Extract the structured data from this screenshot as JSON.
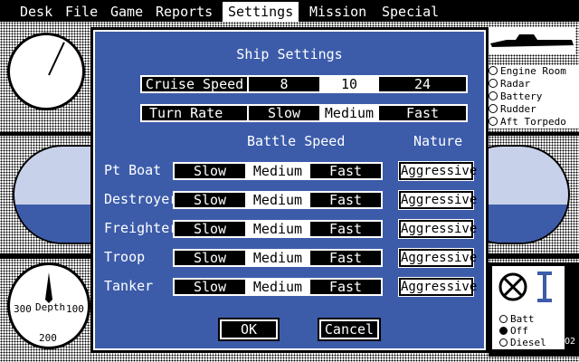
{
  "menubar": {
    "items": [
      "Desk",
      "File",
      "Game",
      "Reports",
      "Settings",
      "Mission",
      "Special"
    ],
    "active": "Settings"
  },
  "background": {
    "systems": [
      "Engine Room",
      "Radar",
      "Battery",
      "Rudder",
      "Aft Torpedo"
    ],
    "depth_gauge": {
      "label": "Depth",
      "left_value": "300",
      "right_value": "100",
      "bottom_value": "200"
    },
    "power_options": [
      "Batt",
      "Off",
      "Diesel"
    ],
    "power_selected": "Off",
    "oxygen_label": "O2"
  },
  "dialog": {
    "title": "Ship Settings",
    "cruise_speed": {
      "label": "Cruise Speed",
      "options": [
        "8",
        "10",
        "24"
      ],
      "selected": "10"
    },
    "turn_rate": {
      "label": "Turn Rate",
      "options": [
        "Slow",
        "Medium",
        "Fast"
      ],
      "selected": "Medium"
    },
    "battle_speed_header": "Battle Speed",
    "nature_header": "Nature",
    "ships": [
      {
        "name": "Pt Boat",
        "options": [
          "Slow",
          "Medium",
          "Fast"
        ],
        "selected": "Medium",
        "nature": "Aggressive"
      },
      {
        "name": "Destroyer",
        "options": [
          "Slow",
          "Medium",
          "Fast"
        ],
        "selected": "Medium",
        "nature": "Aggressive"
      },
      {
        "name": "Freighter",
        "options": [
          "Slow",
          "Medium",
          "Fast"
        ],
        "selected": "Medium",
        "nature": "Aggressive"
      },
      {
        "name": "Troop",
        "options": [
          "Slow",
          "Medium",
          "Fast"
        ],
        "selected": "Medium",
        "nature": "Aggressive"
      },
      {
        "name": "Tanker",
        "options": [
          "Slow",
          "Medium",
          "Fast"
        ],
        "selected": "Medium",
        "nature": "Aggressive"
      }
    ],
    "ok_label": "OK",
    "cancel_label": "Cancel"
  },
  "colors": {
    "dialog_blue": "#3c5caa",
    "sky": "#c8d1ea"
  }
}
